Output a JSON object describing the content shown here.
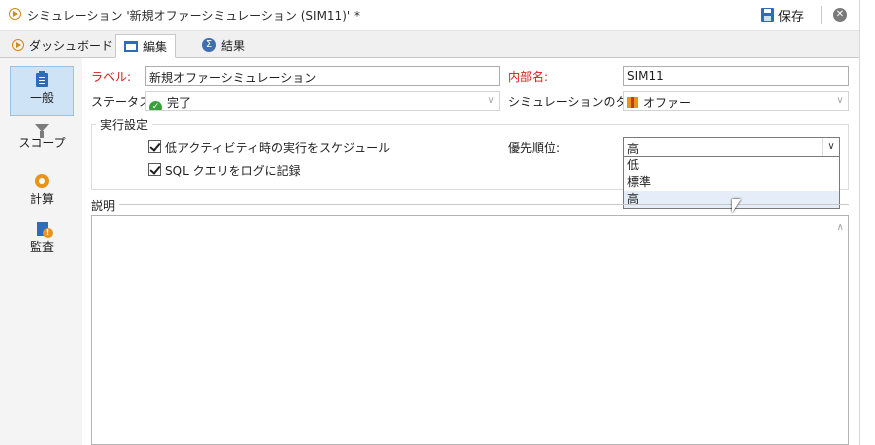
{
  "window": {
    "title": "シミュレーション '新規オファーシミュレーション (SIM11)' *",
    "save_label": "保存",
    "close_glyph": "✕"
  },
  "tabs": [
    {
      "label": "ダッシュボード",
      "icon": "play-icon",
      "active": false
    },
    {
      "label": "編集",
      "icon": "edit-icon",
      "active": true
    },
    {
      "label": "結果",
      "icon": "sigma-icon",
      "active": false
    }
  ],
  "sidebar": {
    "items": [
      {
        "label": "一般",
        "icon": "clipboard-icon",
        "active": true
      },
      {
        "label": "スコープ",
        "icon": "funnel-icon",
        "active": false
      },
      {
        "label": "計算",
        "icon": "gear-icon",
        "active": false
      },
      {
        "label": "監査",
        "icon": "audit-icon",
        "active": false
      }
    ]
  },
  "form": {
    "label_caption": "ラベル:",
    "label_value": "新規オファーシミュレーション",
    "internal_name_caption": "内部名:",
    "internal_name_value": "SIM11",
    "status_caption": "ステータス:",
    "status_value": "完了",
    "sim_type_caption": "シミュレーションのタイプ:",
    "sim_type_value": "オファー",
    "execution_group_title": "実行設定",
    "schedule_checkbox_label": "低アクティビティ時の実行をスケジュール",
    "schedule_checked": true,
    "sql_log_checkbox_label": "SQL クエリをログに記録",
    "sql_log_checked": true,
    "priority_caption": "優先順位:",
    "priority_value": "高",
    "priority_options": [
      "低",
      "標準",
      "高"
    ],
    "priority_highlighted": "高",
    "description_caption": "説明"
  },
  "colors": {
    "accent_blue": "#2e6bb8",
    "required_red": "#d21c1c",
    "status_green": "#3aa03a",
    "orange": "#e8931b"
  }
}
